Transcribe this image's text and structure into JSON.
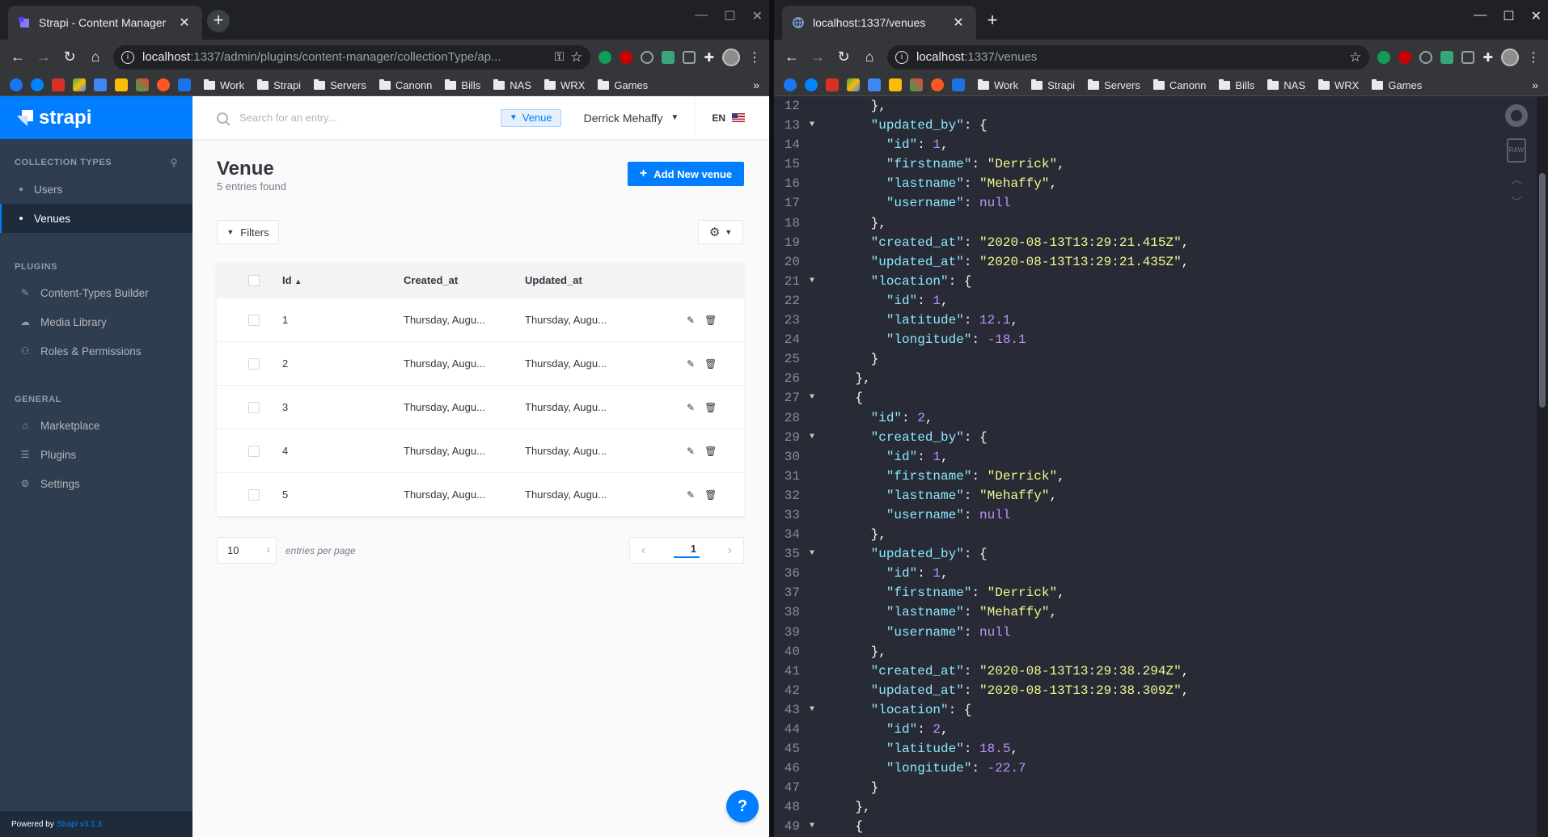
{
  "left": {
    "tab_title": "Strapi - Content Manager",
    "url_host": "localhost",
    "url_rest": ":1337/admin/plugins/content-manager/collectionType/ap...",
    "bookmarks": [
      "Work",
      "Strapi",
      "Servers",
      "Canonn",
      "Bills",
      "NAS",
      "WRX",
      "Games"
    ],
    "sidebar": {
      "brand": "strapi",
      "collection_title": "COLLECTION TYPES",
      "collection_items": [
        "Users",
        "Venues"
      ],
      "plugins_title": "PLUGINS",
      "plugin_items": [
        "Content-Types Builder",
        "Media Library",
        "Roles & Permissions"
      ],
      "general_title": "GENERAL",
      "general_items": [
        "Marketplace",
        "Plugins",
        "Settings"
      ],
      "powered_by": "Powered by",
      "powered_link": "Strapi v3.1.3"
    },
    "topbar": {
      "search_placeholder": "Search for an entry...",
      "filter_chip": "Venue",
      "user": "Derrick Mehaffy",
      "lang": "EN"
    },
    "page": {
      "title": "Venue",
      "subtitle": "5 entries found",
      "add_button": "Add New venue",
      "filters_button": "Filters"
    },
    "table": {
      "headers": [
        "Id",
        "Created_at",
        "Updated_at"
      ],
      "rows": [
        {
          "id": "1",
          "created": "Thursday, Augu...",
          "updated": "Thursday, Augu..."
        },
        {
          "id": "2",
          "created": "Thursday, Augu...",
          "updated": "Thursday, Augu..."
        },
        {
          "id": "3",
          "created": "Thursday, Augu...",
          "updated": "Thursday, Augu..."
        },
        {
          "id": "4",
          "created": "Thursday, Augu...",
          "updated": "Thursday, Augu..."
        },
        {
          "id": "5",
          "created": "Thursday, Augu...",
          "updated": "Thursday, Augu..."
        }
      ]
    },
    "pagination": {
      "per_page": "10",
      "per_page_label": "entries per page",
      "current_page": "1"
    },
    "help": "?"
  },
  "right": {
    "tab_title": "localhost:1337/venues",
    "url_host": "localhost",
    "url_rest": ":1337/venues",
    "bookmarks": [
      "Work",
      "Strapi",
      "Servers",
      "Canonn",
      "Bills",
      "NAS",
      "WRX",
      "Games"
    ],
    "raw_label": "RAW",
    "code_lines": [
      {
        "n": "12",
        "a": "",
        "t": [
          [
            "p",
            "      },"
          ]
        ]
      },
      {
        "n": "13",
        "a": "▼",
        "t": [
          [
            "p",
            "      "
          ],
          [
            "k",
            "\"updated_by\""
          ],
          [
            "p",
            ": {"
          ]
        ]
      },
      {
        "n": "14",
        "a": "",
        "t": [
          [
            "p",
            "        "
          ],
          [
            "k",
            "\"id\""
          ],
          [
            "p",
            ": "
          ],
          [
            "n",
            "1"
          ],
          [
            "p",
            ","
          ]
        ]
      },
      {
        "n": "15",
        "a": "",
        "t": [
          [
            "p",
            "        "
          ],
          [
            "k",
            "\"firstname\""
          ],
          [
            "p",
            ": "
          ],
          [
            "s",
            "\"Derrick\""
          ],
          [
            "p",
            ","
          ]
        ]
      },
      {
        "n": "16",
        "a": "",
        "t": [
          [
            "p",
            "        "
          ],
          [
            "k",
            "\"lastname\""
          ],
          [
            "p",
            ": "
          ],
          [
            "s",
            "\"Mehaffy\""
          ],
          [
            "p",
            ","
          ]
        ]
      },
      {
        "n": "17",
        "a": "",
        "t": [
          [
            "p",
            "        "
          ],
          [
            "k",
            "\"username\""
          ],
          [
            "p",
            ": "
          ],
          [
            "n",
            "null"
          ]
        ]
      },
      {
        "n": "18",
        "a": "",
        "t": [
          [
            "p",
            "      },"
          ]
        ]
      },
      {
        "n": "19",
        "a": "",
        "t": [
          [
            "p",
            "      "
          ],
          [
            "k",
            "\"created_at\""
          ],
          [
            "p",
            ": "
          ],
          [
            "s",
            "\"2020-08-13T13:29:21.415Z\""
          ],
          [
            "p",
            ","
          ]
        ]
      },
      {
        "n": "20",
        "a": "",
        "t": [
          [
            "p",
            "      "
          ],
          [
            "k",
            "\"updated_at\""
          ],
          [
            "p",
            ": "
          ],
          [
            "s",
            "\"2020-08-13T13:29:21.435Z\""
          ],
          [
            "p",
            ","
          ]
        ]
      },
      {
        "n": "21",
        "a": "▼",
        "t": [
          [
            "p",
            "      "
          ],
          [
            "k",
            "\"location\""
          ],
          [
            "p",
            ": {"
          ]
        ]
      },
      {
        "n": "22",
        "a": "",
        "t": [
          [
            "p",
            "        "
          ],
          [
            "k",
            "\"id\""
          ],
          [
            "p",
            ": "
          ],
          [
            "n",
            "1"
          ],
          [
            "p",
            ","
          ]
        ]
      },
      {
        "n": "23",
        "a": "",
        "t": [
          [
            "p",
            "        "
          ],
          [
            "k",
            "\"latitude\""
          ],
          [
            "p",
            ": "
          ],
          [
            "n",
            "12.1"
          ],
          [
            "p",
            ","
          ]
        ]
      },
      {
        "n": "24",
        "a": "",
        "t": [
          [
            "p",
            "        "
          ],
          [
            "k",
            "\"longitude\""
          ],
          [
            "p",
            ": "
          ],
          [
            "n",
            "-18.1"
          ]
        ]
      },
      {
        "n": "25",
        "a": "",
        "t": [
          [
            "p",
            "      }"
          ]
        ]
      },
      {
        "n": "26",
        "a": "",
        "t": [
          [
            "p",
            "    },"
          ]
        ]
      },
      {
        "n": "27",
        "a": "▼",
        "t": [
          [
            "p",
            "    {"
          ]
        ]
      },
      {
        "n": "28",
        "a": "",
        "t": [
          [
            "p",
            "      "
          ],
          [
            "k",
            "\"id\""
          ],
          [
            "p",
            ": "
          ],
          [
            "n",
            "2"
          ],
          [
            "p",
            ","
          ]
        ]
      },
      {
        "n": "29",
        "a": "▼",
        "t": [
          [
            "p",
            "      "
          ],
          [
            "k",
            "\"created_by\""
          ],
          [
            "p",
            ": {"
          ]
        ]
      },
      {
        "n": "30",
        "a": "",
        "t": [
          [
            "p",
            "        "
          ],
          [
            "k",
            "\"id\""
          ],
          [
            "p",
            ": "
          ],
          [
            "n",
            "1"
          ],
          [
            "p",
            ","
          ]
        ]
      },
      {
        "n": "31",
        "a": "",
        "t": [
          [
            "p",
            "        "
          ],
          [
            "k",
            "\"firstname\""
          ],
          [
            "p",
            ": "
          ],
          [
            "s",
            "\"Derrick\""
          ],
          [
            "p",
            ","
          ]
        ]
      },
      {
        "n": "32",
        "a": "",
        "t": [
          [
            "p",
            "        "
          ],
          [
            "k",
            "\"lastname\""
          ],
          [
            "p",
            ": "
          ],
          [
            "s",
            "\"Mehaffy\""
          ],
          [
            "p",
            ","
          ]
        ]
      },
      {
        "n": "33",
        "a": "",
        "t": [
          [
            "p",
            "        "
          ],
          [
            "k",
            "\"username\""
          ],
          [
            "p",
            ": "
          ],
          [
            "n",
            "null"
          ]
        ]
      },
      {
        "n": "34",
        "a": "",
        "t": [
          [
            "p",
            "      },"
          ]
        ]
      },
      {
        "n": "35",
        "a": "▼",
        "t": [
          [
            "p",
            "      "
          ],
          [
            "k",
            "\"updated_by\""
          ],
          [
            "p",
            ": {"
          ]
        ]
      },
      {
        "n": "36",
        "a": "",
        "t": [
          [
            "p",
            "        "
          ],
          [
            "k",
            "\"id\""
          ],
          [
            "p",
            ": "
          ],
          [
            "n",
            "1"
          ],
          [
            "p",
            ","
          ]
        ]
      },
      {
        "n": "37",
        "a": "",
        "t": [
          [
            "p",
            "        "
          ],
          [
            "k",
            "\"firstname\""
          ],
          [
            "p",
            ": "
          ],
          [
            "s",
            "\"Derrick\""
          ],
          [
            "p",
            ","
          ]
        ]
      },
      {
        "n": "38",
        "a": "",
        "t": [
          [
            "p",
            "        "
          ],
          [
            "k",
            "\"lastname\""
          ],
          [
            "p",
            ": "
          ],
          [
            "s",
            "\"Mehaffy\""
          ],
          [
            "p",
            ","
          ]
        ]
      },
      {
        "n": "39",
        "a": "",
        "t": [
          [
            "p",
            "        "
          ],
          [
            "k",
            "\"username\""
          ],
          [
            "p",
            ": "
          ],
          [
            "n",
            "null"
          ]
        ]
      },
      {
        "n": "40",
        "a": "",
        "t": [
          [
            "p",
            "      },"
          ]
        ]
      },
      {
        "n": "41",
        "a": "",
        "t": [
          [
            "p",
            "      "
          ],
          [
            "k",
            "\"created_at\""
          ],
          [
            "p",
            ": "
          ],
          [
            "s",
            "\"2020-08-13T13:29:38.294Z\""
          ],
          [
            "p",
            ","
          ]
        ]
      },
      {
        "n": "42",
        "a": "",
        "t": [
          [
            "p",
            "      "
          ],
          [
            "k",
            "\"updated_at\""
          ],
          [
            "p",
            ": "
          ],
          [
            "s",
            "\"2020-08-13T13:29:38.309Z\""
          ],
          [
            "p",
            ","
          ]
        ]
      },
      {
        "n": "43",
        "a": "▼",
        "t": [
          [
            "p",
            "      "
          ],
          [
            "k",
            "\"location\""
          ],
          [
            "p",
            ": {"
          ]
        ]
      },
      {
        "n": "44",
        "a": "",
        "t": [
          [
            "p",
            "        "
          ],
          [
            "k",
            "\"id\""
          ],
          [
            "p",
            ": "
          ],
          [
            "n",
            "2"
          ],
          [
            "p",
            ","
          ]
        ]
      },
      {
        "n": "45",
        "a": "",
        "t": [
          [
            "p",
            "        "
          ],
          [
            "k",
            "\"latitude\""
          ],
          [
            "p",
            ": "
          ],
          [
            "n",
            "18.5"
          ],
          [
            "p",
            ","
          ]
        ]
      },
      {
        "n": "46",
        "a": "",
        "t": [
          [
            "p",
            "        "
          ],
          [
            "k",
            "\"longitude\""
          ],
          [
            "p",
            ": "
          ],
          [
            "n",
            "-22.7"
          ]
        ]
      },
      {
        "n": "47",
        "a": "",
        "t": [
          [
            "p",
            "      }"
          ]
        ]
      },
      {
        "n": "48",
        "a": "",
        "t": [
          [
            "p",
            "    },"
          ]
        ]
      },
      {
        "n": "49",
        "a": "▼",
        "t": [
          [
            "p",
            "    {"
          ]
        ]
      }
    ]
  },
  "colors": {
    "strapi_blue": "#007eff",
    "sidebar": "#2e3d4f",
    "json_bg": "#282a36"
  },
  "bookmark_icon_colors": [
    "#1877f2",
    "#0084ff",
    "#d93025",
    "#34a853",
    "#4285f4",
    "#fbbc04",
    "#34a853",
    "#ff5722",
    "#1a73e8"
  ],
  "extension_icon_colors": [
    "#0f9d58",
    "#c00",
    "#9aa0a6",
    "#3aa57a",
    "#9aa0a6"
  ]
}
